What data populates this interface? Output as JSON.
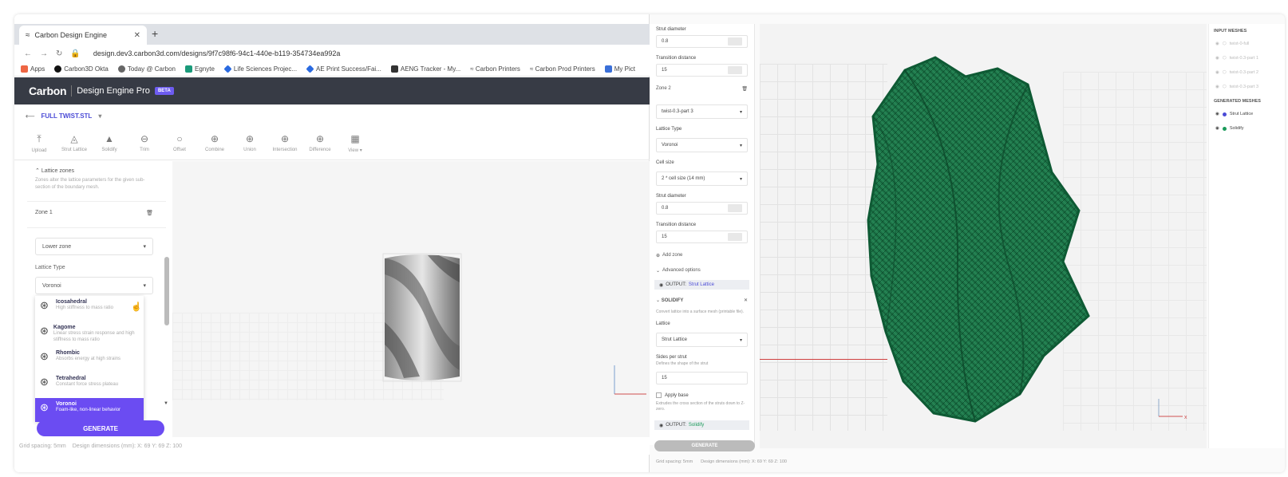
{
  "browser": {
    "tab_title": "Carbon Design Engine",
    "tab_close": "✕",
    "new_tab": "+",
    "url": "design.dev3.carbon3d.com/designs/9f7c98f6-94c1-440e-b119-354734ea992a",
    "bookmarks": [
      "Apps",
      "Carbon3D Okta",
      "Today @ Carbon",
      "Egnyte",
      "Life Sciences Projec...",
      "AE Print Success/Fai...",
      "AENG Tracker - My...",
      "Carbon Printers",
      "Carbon Prod Printers",
      "My Pict"
    ]
  },
  "app": {
    "logo": "Carbon",
    "product": "Design Engine Pro",
    "badge": "BETA",
    "filename": "FULL TWIST.STL",
    "tools": [
      {
        "label": "Upload",
        "icon": "⤒"
      },
      {
        "label": "Strut Lattice",
        "icon": "◬"
      },
      {
        "label": "Solidify",
        "icon": "▲"
      },
      {
        "label": "Trim",
        "icon": "⊖"
      },
      {
        "label": "Offset",
        "icon": "○"
      },
      {
        "label": "Combine",
        "icon": "⊕"
      },
      {
        "label": "Union",
        "icon": "⊕"
      },
      {
        "label": "Intersection",
        "icon": "⊕"
      },
      {
        "label": "Difference",
        "icon": "⊕"
      },
      {
        "label": "View ▾",
        "icon": "▦"
      }
    ]
  },
  "left_panel": {
    "section_title": "Lattice zones",
    "section_desc": "Zones alter the lattice parameters for the given sub-section of the boundary mesh.",
    "zone_label": "Zone 1",
    "zone_select": "Lower zone",
    "lattice_type_label": "Lattice Type",
    "lattice_type_value": "Voronoi",
    "dropdown": [
      {
        "title": "Icosahedral",
        "desc": "High stiffness to mass ratio",
        "selected": false
      },
      {
        "title": "Kagome",
        "desc": "Linear stress strain response and high stiffness to mass ratio",
        "selected": false
      },
      {
        "title": "Rhombic",
        "desc": "Absorbs energy at high strains",
        "selected": false
      },
      {
        "title": "Tetrahedral",
        "desc": "Constant force stress plateau",
        "selected": false
      },
      {
        "title": "Voronoi",
        "desc": "Foam-like, non-linear behavior",
        "selected": true
      }
    ],
    "generate": "GENERATE"
  },
  "status_left": {
    "grid": "Grid spacing: 5mm",
    "dims": "Design dimensions (mm): X: 69  Y: 69  Z: 100"
  },
  "right_panel": {
    "strut_diameter_label": "Strut diameter",
    "strut_diameter_value": "0.8",
    "transition_label": "Transition distance",
    "transition_value": "15",
    "zone2_label": "Zone 2",
    "zone2_select": "twist-0.3-part 3",
    "lattice_type_label": "Lattice Type",
    "lattice_type_value": "Voronoi",
    "cell_size_label": "Cell size",
    "cell_size_value": "2 * cell size (14 mm)",
    "strut_diameter2_label": "Strut diameter",
    "strut_diameter2_value": "0.8",
    "transition2_label": "Transition distance",
    "transition2_value": "15",
    "add_zone": "Add zone",
    "advanced": "Advanced options",
    "output1_prefix": "OUTPUT:",
    "output1_name": "Strut Lattice",
    "solidify_title": "SOLIDIFY",
    "solidify_desc": "Convert lattice into a surface mesh (printable file).",
    "lattice_label": "Lattice",
    "lattice_value": "Strut Lattice",
    "sides_label": "Sides per strut",
    "sides_desc": "Defines the shape of the strut",
    "sides_value": "15",
    "apply_base_label": "Apply base",
    "apply_base_desc": "Extrudes the cross section of the struts down to Z-zero.",
    "output2_prefix": "OUTPUT:",
    "output2_name": "Solidify",
    "generate": "GENERATE"
  },
  "meshes": {
    "input_header": "INPUT MESHES",
    "inputs": [
      "twist-0-full",
      "twist-0.3-part 1",
      "twist-0.3-part 2",
      "twist-0.3-part 3"
    ],
    "generated_header": "GENERATED MESHES",
    "generated": [
      {
        "name": "Strut Lattice",
        "color": "#4b4bd6"
      },
      {
        "name": "Solidify",
        "color": "#1a9a5a"
      }
    ]
  },
  "status_right": {
    "grid": "Grid spacing: 5mm",
    "dims": "Design dimensions (mm): X: 69  Y: 69  Z: 100"
  },
  "colors": {
    "accent": "#6b4cf2",
    "appbar": "#373b45",
    "lattice_green": "#1f7a4c"
  }
}
